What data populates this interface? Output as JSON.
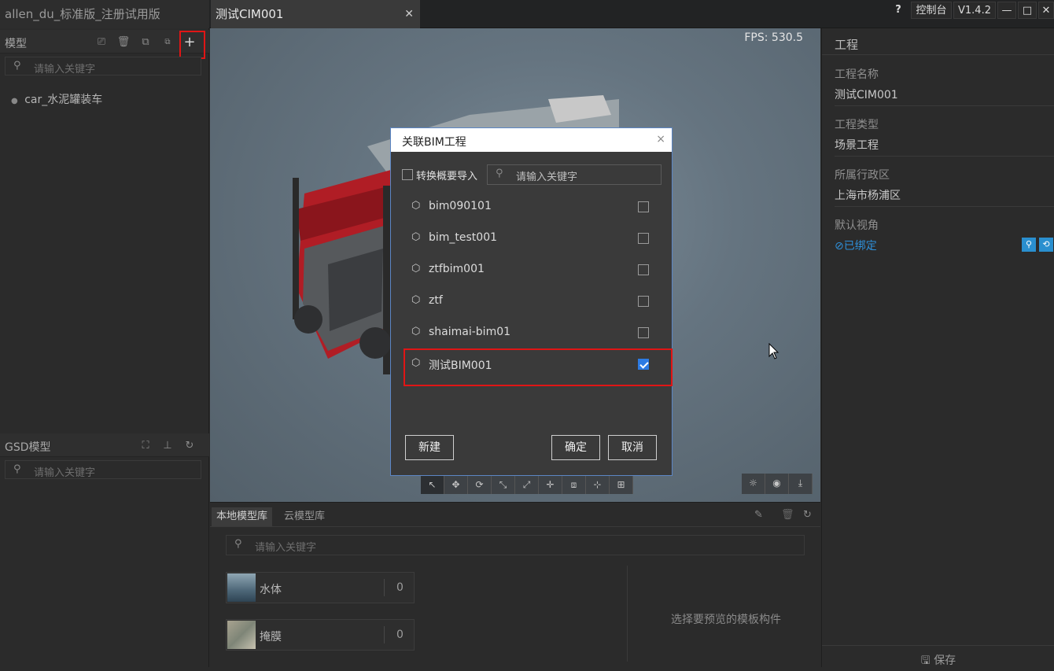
{
  "tabs": [
    {
      "label": "allen_du_标准版_注册试用版"
    },
    {
      "label": "测试CIM001",
      "close": "✕"
    }
  ],
  "toolbar": {
    "help": "?",
    "console": "控制台",
    "version": "V1.4.2",
    "minimize": "—",
    "maximize": "□",
    "close": "✕"
  },
  "model_panel": {
    "title": "模型",
    "search_placeholder": "请输入关键字",
    "items": [
      {
        "label": "car_水泥罐装车"
      }
    ]
  },
  "gsd_panel": {
    "title": "GSD模型",
    "search_placeholder": "请输入关键字"
  },
  "viewport": {
    "fps": "FPS: 530.5"
  },
  "project": {
    "header": "工程",
    "name_label": "工程名称",
    "name_value": "测试CIM001",
    "type_label": "工程类型",
    "type_value": "场景工程",
    "region_label": "所属行政区",
    "region_value": "上海市杨浦区",
    "view_label": "默认视角",
    "view_status": "已绑定",
    "save_label": "保存"
  },
  "library": {
    "tabs": [
      "本地模型库",
      "云模型库"
    ],
    "search_placeholder": "请输入关键字",
    "templates": [
      {
        "name": "水体",
        "count": "0"
      },
      {
        "name": "掩膜",
        "count": "0"
      }
    ],
    "preview_hint": "选择要预览的模板构件"
  },
  "dialog": {
    "title": "关联BIM工程",
    "close": "×",
    "convert_label": "转换概要导入",
    "search_placeholder": "请输入关键字",
    "items": [
      {
        "label": "bim090101",
        "checked": false
      },
      {
        "label": "bim_test001",
        "checked": false
      },
      {
        "label": "ztfbim001",
        "checked": false
      },
      {
        "label": "ztf",
        "checked": false
      },
      {
        "label": "shaimai-bim01",
        "checked": false
      },
      {
        "label": "测试BIM001",
        "checked": true
      }
    ],
    "new_label": "新建",
    "ok_label": "确定",
    "cancel_label": "取消"
  },
  "colors": {
    "accent": "#2d7be3",
    "highlight": "#e01515",
    "bound": "#2e8fd8"
  }
}
